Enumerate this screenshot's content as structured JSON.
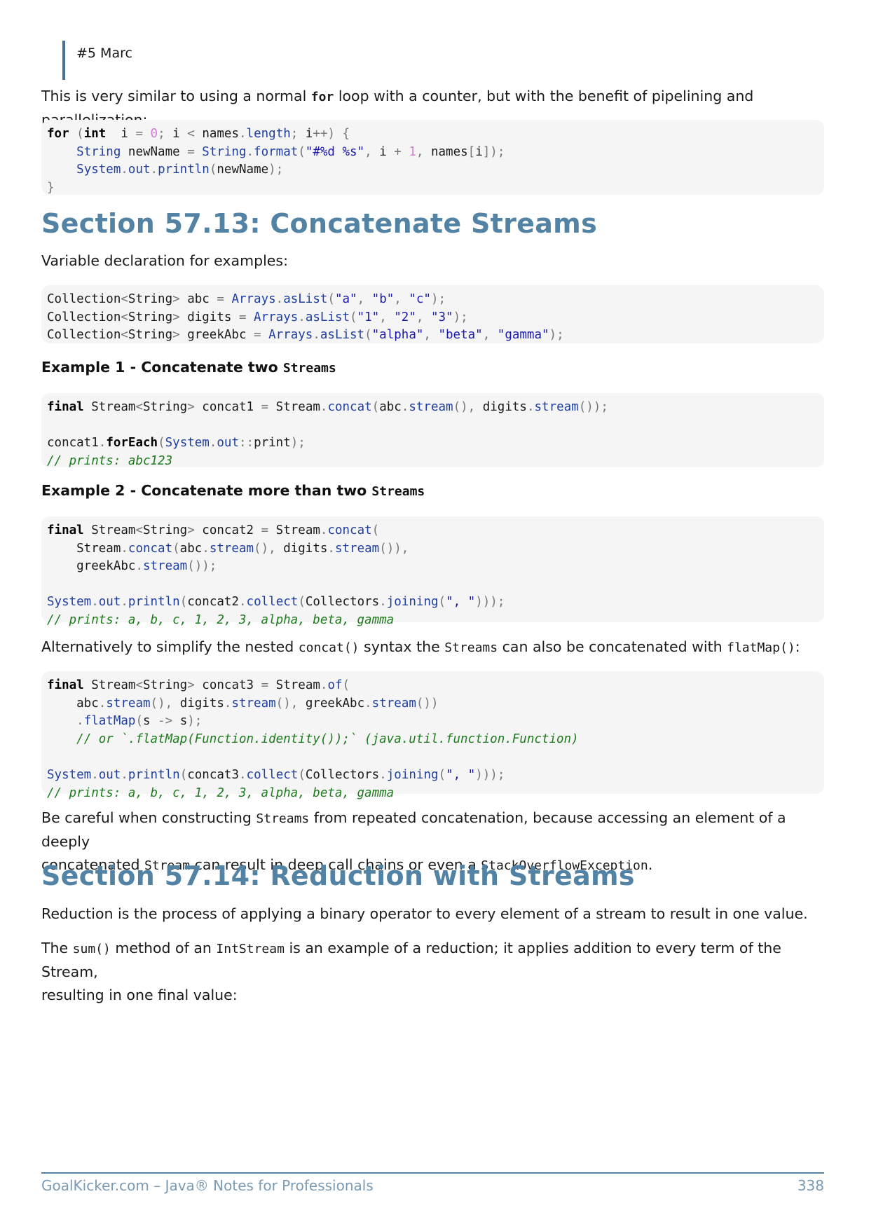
{
  "quote": "#5 Marc",
  "p1": {
    "pre": "This is very similar to using a normal ",
    "code": "for",
    "post": " loop with a counter, but with the benefit of pipelining and parallelization:"
  },
  "code1": [
    [
      [
        "kw",
        "for"
      ],
      [
        "pu",
        " ("
      ],
      [
        "kw",
        "int"
      ],
      [
        "",
        "  i "
      ],
      [
        "pu",
        "= "
      ],
      [
        "nm",
        "0"
      ],
      [
        "pu",
        "; "
      ],
      [
        "",
        "i "
      ],
      [
        "pu",
        "< "
      ],
      [
        "",
        "names"
      ],
      [
        "pu",
        "."
      ],
      [
        "fn",
        "length"
      ],
      [
        "pu",
        "; "
      ],
      [
        "",
        "i"
      ],
      [
        "pu",
        "++) {"
      ]
    ],
    [
      [
        "",
        "    "
      ],
      [
        "ty",
        "String"
      ],
      [
        "",
        " newName "
      ],
      [
        "pu",
        "= "
      ],
      [
        "ty",
        "String"
      ],
      [
        "pu",
        "."
      ],
      [
        "fn",
        "format"
      ],
      [
        "pu",
        "("
      ],
      [
        "st",
        "\"#%d %s\""
      ],
      [
        "pu",
        ", "
      ],
      [
        "",
        "i "
      ],
      [
        "pu",
        "+ "
      ],
      [
        "nm",
        "1"
      ],
      [
        "pu",
        ", "
      ],
      [
        "",
        "names"
      ],
      [
        "pu",
        "["
      ],
      [
        "",
        "i"
      ],
      [
        "pu",
        "]);"
      ]
    ],
    [
      [
        "",
        "    "
      ],
      [
        "ty",
        "System"
      ],
      [
        "pu",
        "."
      ],
      [
        "fn",
        "out"
      ],
      [
        "pu",
        "."
      ],
      [
        "fn",
        "println"
      ],
      [
        "pu",
        "("
      ],
      [
        "",
        "newName"
      ],
      [
        "pu",
        ");"
      ]
    ],
    [
      [
        "pu",
        "}"
      ]
    ]
  ],
  "section1_title": "Section 57.13: Concatenate Streams",
  "p2": "Variable declaration for examples:",
  "code2": [
    [
      [
        "",
        "Collection"
      ],
      [
        "pu",
        "<"
      ],
      [
        "",
        "String"
      ],
      [
        "pu",
        "> "
      ],
      [
        "",
        "abc "
      ],
      [
        "pu",
        "= "
      ],
      [
        "ty",
        "Arrays"
      ],
      [
        "pu",
        "."
      ],
      [
        "fn",
        "asList"
      ],
      [
        "pu",
        "("
      ],
      [
        "st",
        "\"a\""
      ],
      [
        "pu",
        ", "
      ],
      [
        "st",
        "\"b\""
      ],
      [
        "pu",
        ", "
      ],
      [
        "st",
        "\"c\""
      ],
      [
        "pu",
        ");"
      ]
    ],
    [
      [
        "",
        "Collection"
      ],
      [
        "pu",
        "<"
      ],
      [
        "",
        "String"
      ],
      [
        "pu",
        "> "
      ],
      [
        "",
        "digits "
      ],
      [
        "pu",
        "= "
      ],
      [
        "ty",
        "Arrays"
      ],
      [
        "pu",
        "."
      ],
      [
        "fn",
        "asList"
      ],
      [
        "pu",
        "("
      ],
      [
        "st",
        "\"1\""
      ],
      [
        "pu",
        ", "
      ],
      [
        "st",
        "\"2\""
      ],
      [
        "pu",
        ", "
      ],
      [
        "st",
        "\"3\""
      ],
      [
        "pu",
        ");"
      ]
    ],
    [
      [
        "",
        "Collection"
      ],
      [
        "pu",
        "<"
      ],
      [
        "",
        "String"
      ],
      [
        "pu",
        "> "
      ],
      [
        "",
        "greekAbc "
      ],
      [
        "pu",
        "= "
      ],
      [
        "ty",
        "Arrays"
      ],
      [
        "pu",
        "."
      ],
      [
        "fn",
        "asList"
      ],
      [
        "pu",
        "("
      ],
      [
        "st",
        "\"alpha\""
      ],
      [
        "pu",
        ", "
      ],
      [
        "st",
        "\"beta\""
      ],
      [
        "pu",
        ", "
      ],
      [
        "st",
        "\"gamma\""
      ],
      [
        "pu",
        ");"
      ]
    ]
  ],
  "ex1": {
    "text": "Example 1 - Concatenate two ",
    "code": "Streams"
  },
  "code3": [
    [
      [
        "kw",
        "final"
      ],
      [
        "",
        " Stream"
      ],
      [
        "pu",
        "<"
      ],
      [
        "",
        "String"
      ],
      [
        "pu",
        "> "
      ],
      [
        "",
        "concat1 "
      ],
      [
        "pu",
        "= "
      ],
      [
        "",
        "Stream"
      ],
      [
        "pu",
        "."
      ],
      [
        "fn",
        "concat"
      ],
      [
        "pu",
        "("
      ],
      [
        "",
        "abc"
      ],
      [
        "pu",
        "."
      ],
      [
        "fn",
        "stream"
      ],
      [
        "pu",
        "(), "
      ],
      [
        "",
        "digits"
      ],
      [
        "pu",
        "."
      ],
      [
        "fn",
        "stream"
      ],
      [
        "pu",
        "());"
      ]
    ],
    [
      [
        "",
        ""
      ]
    ],
    [
      [
        "",
        "concat1"
      ],
      [
        "pu",
        "."
      ],
      [
        "bf",
        "forEach"
      ],
      [
        "pu",
        "("
      ],
      [
        "ty",
        "System"
      ],
      [
        "pu",
        "."
      ],
      [
        "fn",
        "out"
      ],
      [
        "pu",
        "::"
      ],
      [
        "",
        "print"
      ],
      [
        "pu",
        ");"
      ]
    ],
    [
      [
        "cm",
        "// prints: abc123"
      ]
    ]
  ],
  "ex2": {
    "text": "Example 2 - Concatenate more than two ",
    "code": "Streams"
  },
  "code4": [
    [
      [
        "kw",
        "final"
      ],
      [
        "",
        " Stream"
      ],
      [
        "pu",
        "<"
      ],
      [
        "",
        "String"
      ],
      [
        "pu",
        "> "
      ],
      [
        "",
        "concat2 "
      ],
      [
        "pu",
        "= "
      ],
      [
        "",
        "Stream"
      ],
      [
        "pu",
        "."
      ],
      [
        "fn",
        "concat"
      ],
      [
        "pu",
        "("
      ]
    ],
    [
      [
        "",
        "    Stream"
      ],
      [
        "pu",
        "."
      ],
      [
        "fn",
        "concat"
      ],
      [
        "pu",
        "("
      ],
      [
        "",
        "abc"
      ],
      [
        "pu",
        "."
      ],
      [
        "fn",
        "stream"
      ],
      [
        "pu",
        "(), "
      ],
      [
        "",
        "digits"
      ],
      [
        "pu",
        "."
      ],
      [
        "fn",
        "stream"
      ],
      [
        "pu",
        "()),"
      ]
    ],
    [
      [
        "",
        "    greekAbc"
      ],
      [
        "pu",
        "."
      ],
      [
        "fn",
        "stream"
      ],
      [
        "pu",
        "());"
      ]
    ],
    [
      [
        "",
        ""
      ]
    ],
    [
      [
        "ty",
        "System"
      ],
      [
        "pu",
        "."
      ],
      [
        "fn",
        "out"
      ],
      [
        "pu",
        "."
      ],
      [
        "fn",
        "println"
      ],
      [
        "pu",
        "("
      ],
      [
        "",
        "concat2"
      ],
      [
        "pu",
        "."
      ],
      [
        "fn",
        "collect"
      ],
      [
        "pu",
        "("
      ],
      [
        "",
        "Collectors"
      ],
      [
        "pu",
        "."
      ],
      [
        "fn",
        "joining"
      ],
      [
        "pu",
        "("
      ],
      [
        "st",
        "\", \""
      ],
      [
        "pu",
        ")));"
      ]
    ],
    [
      [
        "cm",
        "// prints: a, b, c, 1, 2, 3, alpha, beta, gamma"
      ]
    ]
  ],
  "p3": {
    "a": "Alternatively to simplify the nested ",
    "b": "concat()",
    "c": " syntax the ",
    "d": "Streams",
    "e": " can also be concatenated with ",
    "f": "flatMap()",
    "g": ":"
  },
  "code5": [
    [
      [
        "kw",
        "final"
      ],
      [
        "",
        " Stream"
      ],
      [
        "pu",
        "<"
      ],
      [
        "",
        "String"
      ],
      [
        "pu",
        "> "
      ],
      [
        "",
        "concat3 "
      ],
      [
        "pu",
        "= "
      ],
      [
        "",
        "Stream"
      ],
      [
        "pu",
        "."
      ],
      [
        "fn",
        "of"
      ],
      [
        "pu",
        "("
      ]
    ],
    [
      [
        "",
        "    abc"
      ],
      [
        "pu",
        "."
      ],
      [
        "fn",
        "stream"
      ],
      [
        "pu",
        "(), "
      ],
      [
        "",
        "digits"
      ],
      [
        "pu",
        "."
      ],
      [
        "fn",
        "stream"
      ],
      [
        "pu",
        "(), "
      ],
      [
        "",
        "greekAbc"
      ],
      [
        "pu",
        "."
      ],
      [
        "fn",
        "stream"
      ],
      [
        "pu",
        "())"
      ]
    ],
    [
      [
        "",
        "    "
      ],
      [
        "pu",
        "."
      ],
      [
        "fn",
        "flatMap"
      ],
      [
        "pu",
        "("
      ],
      [
        "",
        "s "
      ],
      [
        "pu",
        "-> "
      ],
      [
        "",
        "s"
      ],
      [
        "pu",
        ");"
      ]
    ],
    [
      [
        "",
        "    "
      ],
      [
        "cm",
        "// or `.flatMap(Function.identity());` (java.util.function.Function)"
      ]
    ],
    [
      [
        "",
        ""
      ]
    ],
    [
      [
        "ty",
        "System"
      ],
      [
        "pu",
        "."
      ],
      [
        "fn",
        "out"
      ],
      [
        "pu",
        "."
      ],
      [
        "fn",
        "println"
      ],
      [
        "pu",
        "("
      ],
      [
        "",
        "concat3"
      ],
      [
        "pu",
        "."
      ],
      [
        "fn",
        "collect"
      ],
      [
        "pu",
        "("
      ],
      [
        "",
        "Collectors"
      ],
      [
        "pu",
        "."
      ],
      [
        "fn",
        "joining"
      ],
      [
        "pu",
        "("
      ],
      [
        "st",
        "\", \""
      ],
      [
        "pu",
        ")));"
      ]
    ],
    [
      [
        "cm",
        "// prints: a, b, c, 1, 2, 3, alpha, beta, gamma"
      ]
    ]
  ],
  "p4": {
    "a": "Be careful when constructing ",
    "b": "Streams",
    "c": " from repeated concatenation, because accessing an element of a deeply",
    "d": "concatenated ",
    "e": "Stream",
    "f": " can result in deep call chains or even a ",
    "g": "StackOverflowException",
    "h": "."
  },
  "section2_title": "Section 57.14: Reduction with Streams",
  "p5": "Reduction is the process of applying a binary operator to every element of a stream to result in one value.",
  "p6": {
    "a": "The ",
    "b": "sum()",
    "c": " method of an ",
    "d": "IntStream",
    "e": " is an example of a reduction; it applies addition to every term of the Stream,",
    "f": "resulting in one final value:"
  },
  "footer": {
    "left": "GoalKicker.com – Java® Notes for Professionals",
    "page": "338"
  }
}
